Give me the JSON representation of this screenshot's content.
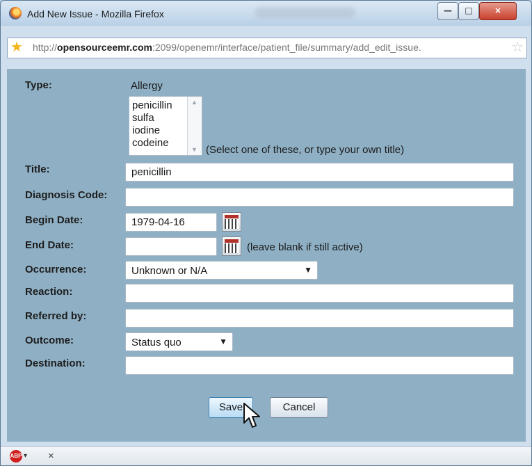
{
  "window": {
    "title": "Add New Issue - Mozilla Firefox"
  },
  "browser": {
    "url_prefix": "http://",
    "url_domain": "opensourceemr.com",
    "url_rest": ":2099/openemr/interface/patient_file/summary/add_edit_issue.",
    "ff_icon": "firefox-logo-icon",
    "star_icon": "favorite-star-icon",
    "bookmark_icon": "bookmark-star-icon"
  },
  "form": {
    "type_label": "Type:",
    "type_value": "Allergy",
    "title_options": [
      "penicillin",
      "sulfa",
      "iodine",
      "codeine"
    ],
    "title_hint": "(Select one of these, or type your own title)",
    "title_label": "Title:",
    "title_value": "penicillin",
    "diagnosis_label": "Diagnosis Code:",
    "diagnosis_value": "",
    "begin_label": "Begin Date:",
    "begin_value": "1979-04-16",
    "end_label": "End Date:",
    "end_value": "",
    "end_hint": "(leave blank if still active)",
    "occurrence_label": "Occurrence:",
    "occurrence_value": "Unknown or N/A",
    "reaction_label": "Reaction:",
    "reaction_value": "",
    "referred_label": "Referred by:",
    "referred_value": "",
    "outcome_label": "Outcome:",
    "outcome_value": "Status quo",
    "destination_label": "Destination:",
    "destination_value": ""
  },
  "buttons": {
    "save": "Save",
    "cancel": "Cancel"
  },
  "status": {
    "adblock_label": "ABP",
    "close": "×"
  }
}
